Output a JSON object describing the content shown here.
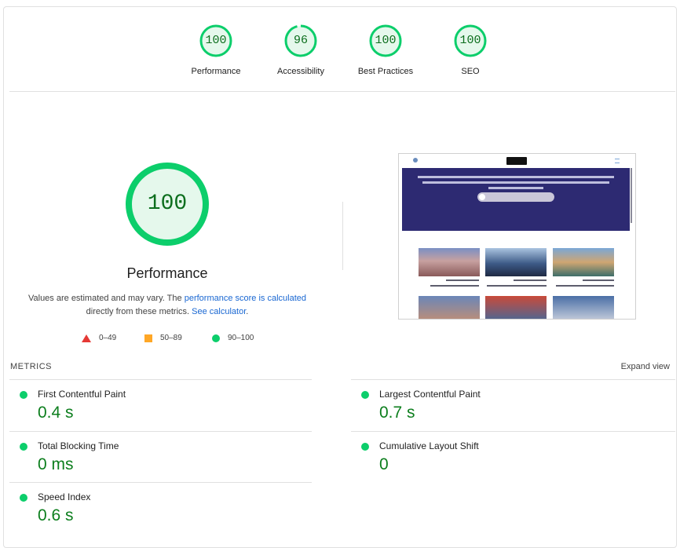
{
  "categories": [
    {
      "label": "Performance",
      "score": "100",
      "fraction": 1.0
    },
    {
      "label": "Accessibility",
      "score": "96",
      "fraction": 0.96
    },
    {
      "label": "Best Practices",
      "score": "100",
      "fraction": 1.0
    },
    {
      "label": "SEO",
      "score": "100",
      "fraction": 1.0
    }
  ],
  "main": {
    "score": "100",
    "fraction": 1.0,
    "title": "Performance",
    "desc_1": "Values are estimated and may vary. The ",
    "desc_link_1": "performance score is calculated",
    "desc_2": " directly from these metrics. ",
    "desc_link_2": "See calculator",
    "desc_3": "."
  },
  "legend": {
    "fail": "0–49",
    "average": "50–89",
    "pass": "90–100"
  },
  "metrics": {
    "label": "METRICS",
    "expand_label": "Expand view",
    "items": [
      {
        "name": "First Contentful Paint",
        "value": "0.4 s"
      },
      {
        "name": "Largest Contentful Paint",
        "value": "0.7 s"
      },
      {
        "name": "Total Blocking Time",
        "value": "0 ms"
      },
      {
        "name": "Cumulative Layout Shift",
        "value": "0"
      },
      {
        "name": "Speed Index",
        "value": "0.6 s"
      }
    ]
  },
  "colors": {
    "pass": "#0cce6b",
    "pass_text": "#0c6e1d",
    "pass_bg": "#e5f8ec",
    "average": "#ffa726",
    "fail": "#e53935",
    "link": "#1967d2"
  }
}
